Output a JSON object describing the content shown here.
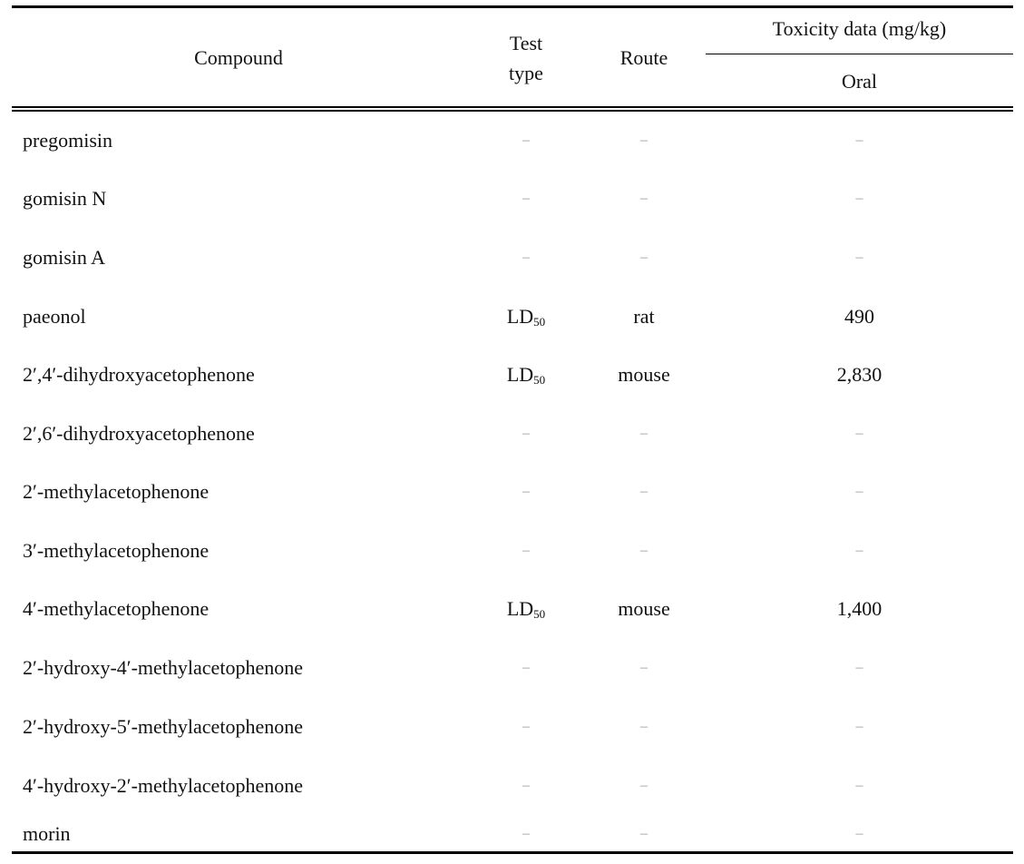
{
  "table": {
    "headers": {
      "compound": "Compound",
      "test_type_line1": "Test",
      "test_type_line2": "type",
      "route": "Route",
      "toxicity": "Toxicity data (mg/kg)",
      "oral": "Oral"
    },
    "empty_marker": "–",
    "rows": [
      {
        "compound": "pregomisin",
        "test_type": "",
        "test_sub": "",
        "route": "",
        "oral": ""
      },
      {
        "compound": "gomisin  N",
        "test_type": "",
        "test_sub": "",
        "route": "",
        "oral": ""
      },
      {
        "compound": "gomisin  A",
        "test_type": "",
        "test_sub": "",
        "route": "",
        "oral": ""
      },
      {
        "compound": "paeonol",
        "test_type": "LD",
        "test_sub": "50",
        "route": "rat",
        "oral": "490"
      },
      {
        "compound": "2′,4′-dihydroxyacetophenone",
        "test_type": "LD",
        "test_sub": "50",
        "route": "mouse",
        "oral": "2,830"
      },
      {
        "compound": "2′,6′-dihydroxyacetophenone",
        "test_type": "",
        "test_sub": "",
        "route": "",
        "oral": ""
      },
      {
        "compound": "2′-methylacetophenone",
        "test_type": "",
        "test_sub": "",
        "route": "",
        "oral": ""
      },
      {
        "compound": "3′-methylacetophenone",
        "test_type": "",
        "test_sub": "",
        "route": "",
        "oral": ""
      },
      {
        "compound": "4′-methylacetophenone",
        "test_type": "LD",
        "test_sub": "50",
        "route": "mouse",
        "oral": "1,400"
      },
      {
        "compound": "2′-hydroxy-4′-methylacetophenone",
        "test_type": "",
        "test_sub": "",
        "route": "",
        "oral": ""
      },
      {
        "compound": "2′-hydroxy-5′-methylacetophenone",
        "test_type": "",
        "test_sub": "",
        "route": "",
        "oral": ""
      },
      {
        "compound": "4′-hydroxy-2′-methylacetophenone",
        "test_type": "",
        "test_sub": "",
        "route": "",
        "oral": ""
      },
      {
        "compound": "morin",
        "test_type": "",
        "test_sub": "",
        "route": "",
        "oral": ""
      }
    ]
  }
}
